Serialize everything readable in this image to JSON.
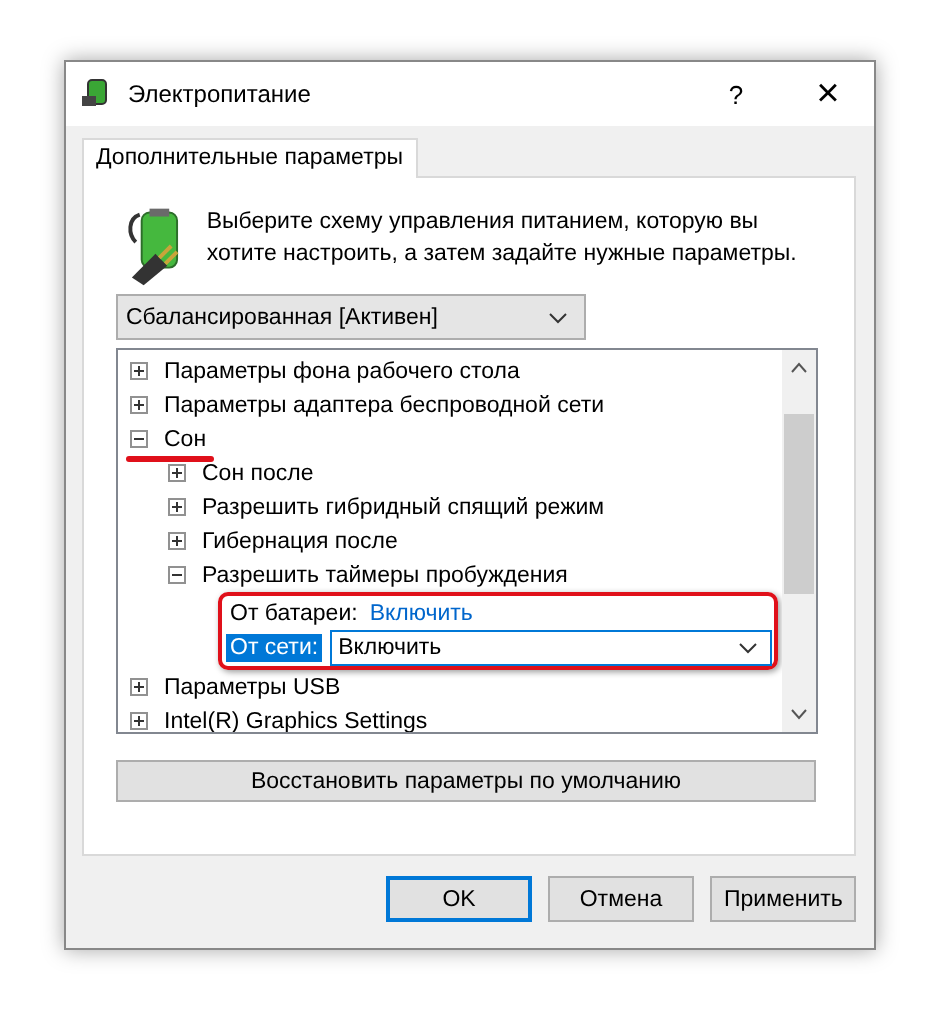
{
  "window": {
    "title": "Электропитание",
    "help": "?",
    "close": "×"
  },
  "tabs": [
    {
      "label": "Дополнительные параметры",
      "selected": true
    }
  ],
  "description": "Выберите схему управления питанием, которую вы хотите настроить, а затем задайте нужные параметры.",
  "scheme_dropdown": {
    "value": "Сбалансированная [Активен]"
  },
  "tree": [
    {
      "label": "Параметры фона рабочего стола",
      "expanded": false
    },
    {
      "label": "Параметры адаптера беспроводной сети",
      "expanded": false
    },
    {
      "label": "Сон",
      "expanded": true,
      "underlined": true,
      "children": [
        {
          "label": "Сон после",
          "expanded": false
        },
        {
          "label": "Разрешить гибридный спящий режим",
          "expanded": false
        },
        {
          "label": "Гибернация после",
          "expanded": false
        },
        {
          "label": "Разрешить таймеры пробуждения",
          "expanded": true,
          "settings": [
            {
              "label": "От батареи:",
              "value": "Включить",
              "selected": false
            },
            {
              "label": "От сети:",
              "value": "Включить",
              "selected": true
            }
          ]
        }
      ]
    },
    {
      "label": "Параметры USB",
      "expanded": false
    },
    {
      "label": "Intel(R) Graphics Settings",
      "expanded": false
    }
  ],
  "restore_button": "Восстановить параметры по умолчанию",
  "buttons": [
    {
      "label": "OK",
      "default": true
    },
    {
      "label": "Отмена",
      "default": false
    },
    {
      "label": "Применить",
      "default": false
    }
  ]
}
